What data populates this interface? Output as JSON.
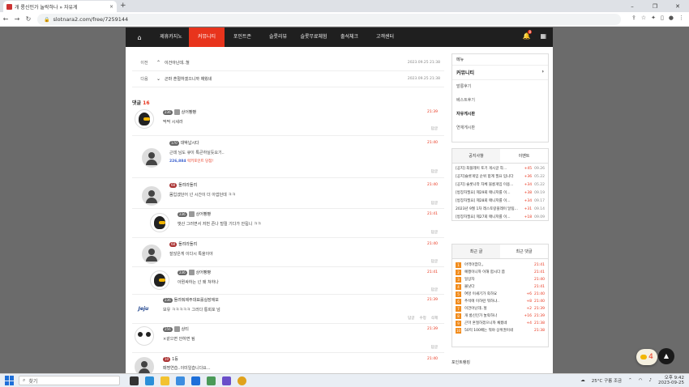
{
  "browser": {
    "tab_title": "개 롱신인가 눌락하나 » 자유게",
    "tab_close": "×",
    "new_tab": "+",
    "url": "slotnara2.com/free/7259144",
    "win_min": "–",
    "win_max": "❐",
    "win_close": "✕",
    "back": "←",
    "forward": "→",
    "reload": "↻"
  },
  "site_nav": {
    "items": [
      "제휴카지노",
      "커뮤니티",
      "포인트존",
      "슬롯리뷰",
      "슬롯무료체험",
      "출석체크",
      "고객센터"
    ],
    "active_index": 1,
    "bell_count": "8"
  },
  "prev_next": {
    "prev_label": "이전",
    "prev_title": "이건아닌데..헐",
    "prev_date": "2023.09.25 21:38",
    "next_label": "다음",
    "next_title": "곤마 혼절하겠으니까 채웠네",
    "next_date": "2023.09.25 21:38"
  },
  "comments_header": {
    "label": "댓글",
    "count": "16"
  },
  "comments": [
    {
      "level": "236",
      "nick": "상어빵빵",
      "text": "딱딱 시세라",
      "time": "21:39",
      "reply": "답글"
    },
    {
      "level": "170",
      "nick": "대박납시다",
      "text": "근데 님도 큐이 톡큰하실듯요기..",
      "point_value": "226,884",
      "point_label": "럭키포인트 당첨!",
      "time": "21:40",
      "reply": "답글"
    },
    {
      "level": "68",
      "nick": "돌려라돌려",
      "text": "몸입겠던어 넌 시간이 더 아깝던데 ㅋㅋ",
      "time": "21:40",
      "reply": "답글"
    },
    {
      "level": "236",
      "nick": "상어빵빵",
      "text": "뱃산 그러면서 저번 존나 털릴 기다가 안됩니 ㅋㅋ",
      "time": "21:41",
      "reply": "답글"
    },
    {
      "level": "68",
      "nick": "돌려라돌려",
      "text": "잘않은게 이다시 톡올이야",
      "time": "21:40",
      "reply": "답글"
    },
    {
      "level": "236",
      "nick": "상어빵빵",
      "text": "아뭔싸하는 넌 왜 쳐하나",
      "time": "21:41",
      "reply": "답글"
    },
    {
      "level": "236",
      "nick": "돌려줘제주대표롤실장애보",
      "text": "보유 ㅋㅋㅋㅋㅋ 그러다 통회포 넘",
      "time": "21:39",
      "reply": "답글",
      "edit": "수정",
      "delete": "삭제"
    },
    {
      "level": "256",
      "nick": "상티",
      "text": "×같으면 안하면 됨",
      "time": "21:39",
      "reply": "답글"
    },
    {
      "level": "10",
      "nick": "1등",
      "text": "패명연습..이미일습니다요...",
      "time": "21:40"
    }
  ],
  "sidebar": {
    "menu_title": "메뉴",
    "community_title": "커뮤니티",
    "community_arrow": "›",
    "items": [
      "발롱후기",
      "베스트후기",
      "자유게시판",
      "연재게시판"
    ],
    "bold_index": 2,
    "notice_tabs": [
      "공지사항",
      "이벤트"
    ],
    "notices": [
      {
        "title": "[공지] 최플레이 토기 게시글 작...",
        "count": "+45",
        "date": "09.26"
      },
      {
        "title": "[공지]슬롯게임 순위 합계 필요 입니다",
        "count": "+36",
        "date": "05.22"
      },
      {
        "title": "[공지] 슬롯나라 자체 블롱게임 이용...",
        "count": "+34",
        "date": "05.22"
      },
      {
        "title": "[방장자필요] 제29회 매니저를 이...",
        "count": "+38",
        "date": "09.19"
      },
      {
        "title": "[방장자필요] 제28회 매니저를 이...",
        "count": "+34",
        "date": "09.17"
      },
      {
        "title": "2023년 9월 1차 레스토랑플레이 달팀...",
        "count": "+31",
        "date": "09.14"
      },
      {
        "title": "[방장자필요] 제27회 매니저를 이...",
        "count": "+18",
        "date": "09.09"
      }
    ],
    "recent_tabs": [
      "최근 글",
      "최근 댓글"
    ],
    "recent": [
      {
        "n": "1",
        "title": "아역아깝다,,",
        "count": "",
        "time": "21:41"
      },
      {
        "n": "2",
        "title": "예쩡이니까 이해 합시다 쯤",
        "count": "",
        "time": "21:41"
      },
      {
        "n": "3",
        "title": "일상자",
        "count": "",
        "time": "21:40"
      },
      {
        "n": "4",
        "title": "몰낫다",
        "count": "",
        "time": "21:41"
      },
      {
        "n": "5",
        "title": "여엉 이새기가 죽하요",
        "count": "+6",
        "time": "21:40"
      },
      {
        "n": "6",
        "title": "추석에 이하련 뭐하냐..",
        "count": "+8",
        "time": "21:40"
      },
      {
        "n": "7",
        "title": "이건아닌데..헐",
        "count": "+2",
        "time": "21:39"
      },
      {
        "n": "8",
        "title": "개 롱신인가 눌락하나",
        "count": "+16",
        "time": "21:39"
      },
      {
        "n": "9",
        "title": "곤마 혼절하겠으니까 채웠네",
        "count": "+4",
        "time": "21:38"
      },
      {
        "n": "10",
        "title": "50억 100배는 뭐야 상위권이네",
        "count": "",
        "time": "21:38"
      }
    ],
    "point_ranking": "포인트랭킹"
  },
  "floating": {
    "chat_count": "4",
    "top_arrow": "▲"
  },
  "taskbar": {
    "search_placeholder": "찾기",
    "weather": "25°C 구름 조금",
    "time": "오후 9:42",
    "date": "2023-09-25"
  },
  "colors": {
    "accent": "#e8341c",
    "nav_bg": "#1f1f1f"
  }
}
